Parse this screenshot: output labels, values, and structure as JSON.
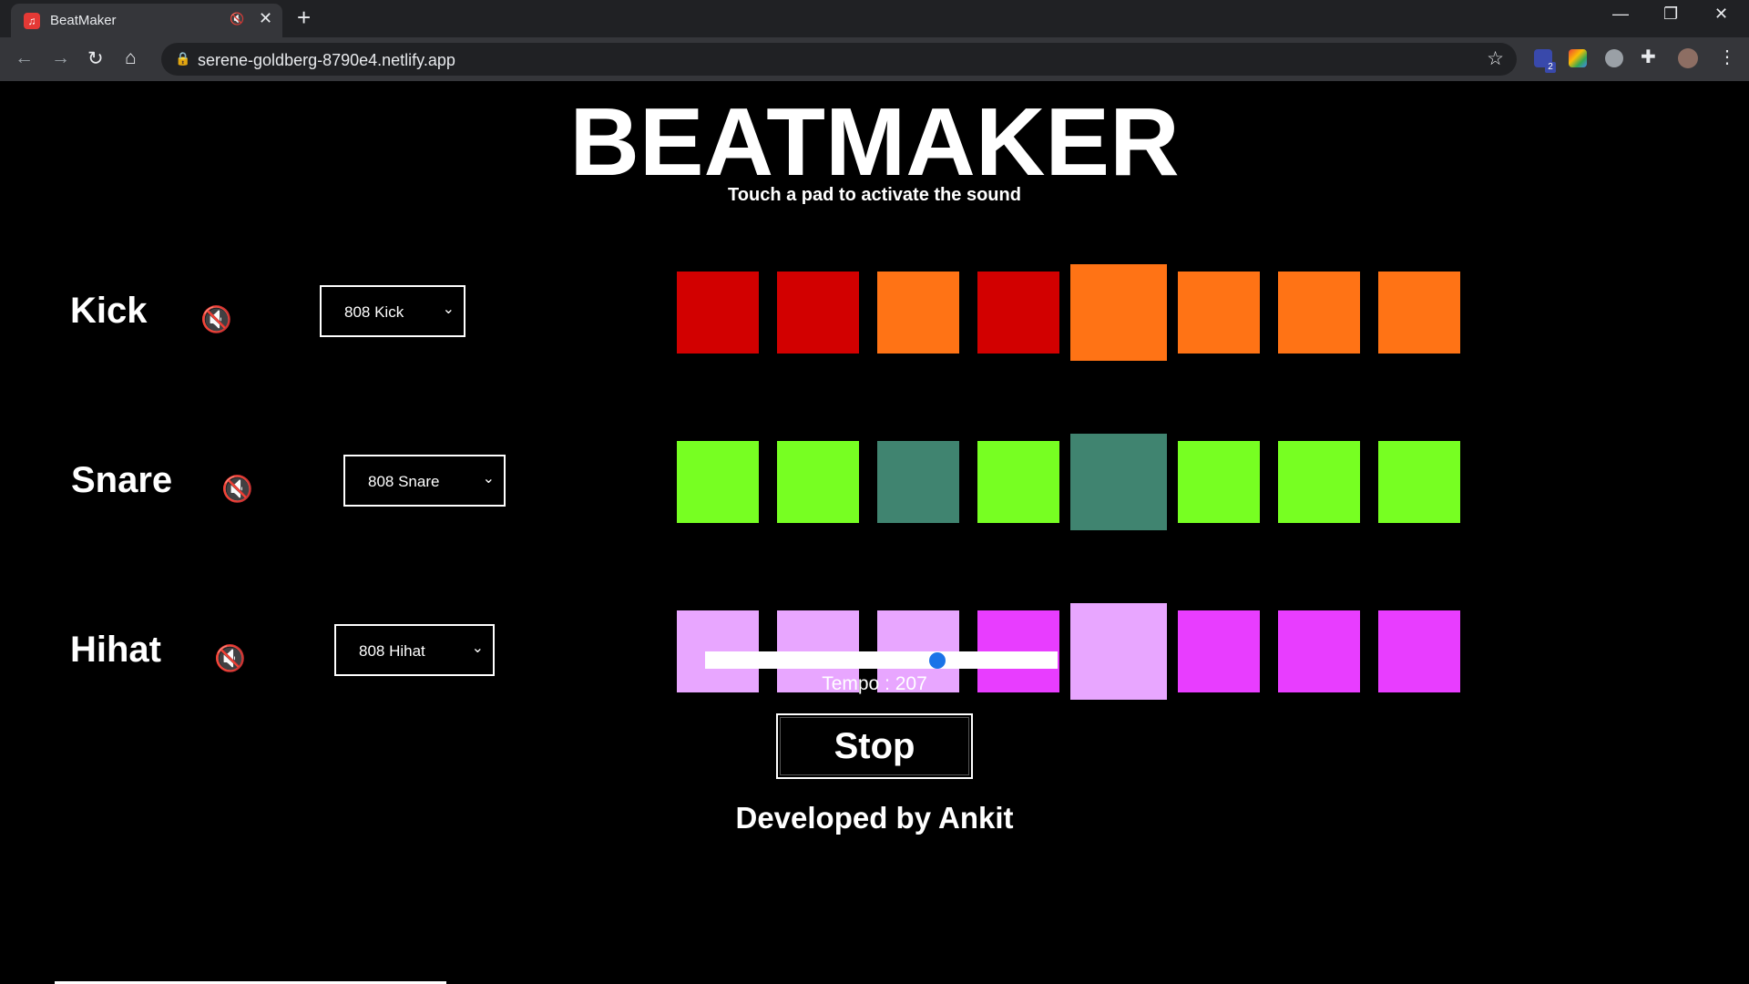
{
  "browser": {
    "tab_title": "BeatMaker",
    "url": "serene-goldberg-8790e4.netlify.app",
    "extension_badge": "2"
  },
  "page": {
    "title": "BEATMAKER",
    "subtitle": "Touch a pad to activate the sound",
    "tracks": [
      {
        "name": "Kick",
        "selected_sound": "808 Kick"
      },
      {
        "name": "Snare",
        "selected_sound": "808 Snare"
      },
      {
        "name": "Hihat",
        "selected_sound": "808 Hihat"
      }
    ],
    "tempo_label": "Tempo : 207",
    "tempo_value": 207,
    "stop_label": "Stop",
    "footer": "Developed by Ankit"
  },
  "colors": {
    "kick_active": "#d20000",
    "kick_inactive": "#ff7315",
    "snare_active": "#408470",
    "snare_inactive": "#77ff22",
    "hihat_active": "#e8a6ff",
    "hihat_inactive": "#e83dff"
  },
  "pads": {
    "kick": [
      true,
      true,
      false,
      true,
      false,
      false,
      false,
      false
    ],
    "snare": [
      false,
      false,
      true,
      false,
      true,
      false,
      false,
      false
    ],
    "hihat": [
      true,
      true,
      true,
      false,
      true,
      false,
      false,
      false
    ],
    "current_step": 5
  }
}
